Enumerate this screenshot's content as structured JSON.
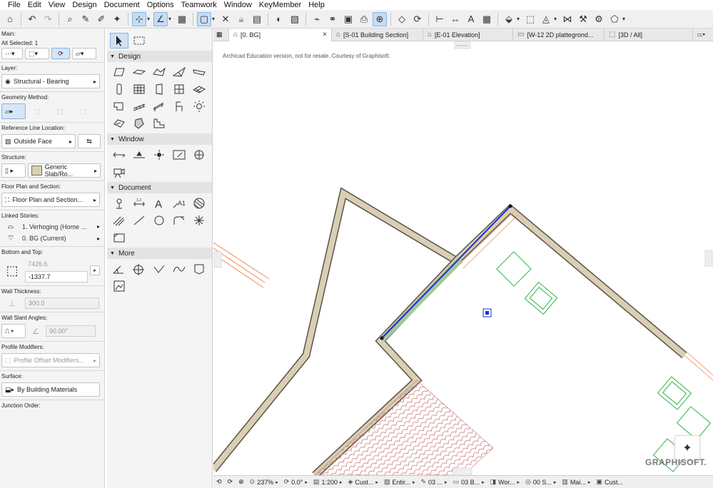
{
  "menu": [
    "File",
    "Edit",
    "View",
    "Design",
    "Document",
    "Options",
    "Teamwork",
    "Window",
    "KeyMember",
    "Help"
  ],
  "infobox": {
    "main_title": "Main:",
    "all_selected": "All Selected: 1",
    "layer_title": "Layer:",
    "layer_value": "Structural - Bearing",
    "geometry_title": "Geometry Method:",
    "refline_title": "Reference Line Location:",
    "refline_value": "Outside Face",
    "structure_title": "Structure:",
    "structure_value": "Generic Slab/Ro...",
    "floorplan_title": "Floor Plan and Section:",
    "floorplan_value": "Floor Plan and Section...",
    "linked_title": "Linked Stories:",
    "linked_top": "1. Verhoging (Home ...",
    "linked_bottom": "0. BG (Current)",
    "bottomtop_title": "Bottom and Top:",
    "top_value": "7426.6",
    "bottom_value": "-1337.7",
    "thickness_title": "Wall Thickness:",
    "thickness_value": "300.0",
    "slant_title": "Wall Slant Angles:",
    "slant_value": "90.00°",
    "profile_title": "Profile Modifiers:",
    "profile_value": "Profile Offset Modifiers...",
    "surface_title": "Surface:",
    "surface_value": "By Building Materials",
    "junction_title": "Junction Order:"
  },
  "toolbox": {
    "groups": [
      "Design",
      "Window",
      "Document",
      "More"
    ]
  },
  "tabs": [
    {
      "label": "[0. BG]",
      "icon": "floorplan-icon"
    },
    {
      "label": "[S-01 Building Section]",
      "icon": "section-icon"
    },
    {
      "label": "[E-01 Elevation]",
      "icon": "elevation-icon"
    },
    {
      "label": "[W-12 2D plattegrond...",
      "icon": "worksheet-icon"
    },
    {
      "label": "[3D / All]",
      "icon": "3d-icon"
    }
  ],
  "canvas": {
    "watermark": "Archicad Education version, not for resale. Courtesy of Graphisoft.",
    "brand": "GRAPHISOFT."
  },
  "status": {
    "zoom": "237%",
    "angle": "0.0°",
    "scale": "1:200",
    "layer_combo": "Cust...",
    "model_view": "Entir...",
    "pen_set": "03 ...",
    "structure": "03 B...",
    "work": "Wor...",
    "story": "00 S...",
    "renov": "Mai...",
    "custom": "Cust..."
  },
  "colors": {
    "wall_fill": "#d8cfb4",
    "wall_stroke": "#5b5346",
    "selected_edge": "#1f2fd6",
    "selected_fill": "#a6c79a",
    "object_green": "#2db34a",
    "orange_line": "#ef8a55",
    "hatch_red": "#c87878"
  }
}
